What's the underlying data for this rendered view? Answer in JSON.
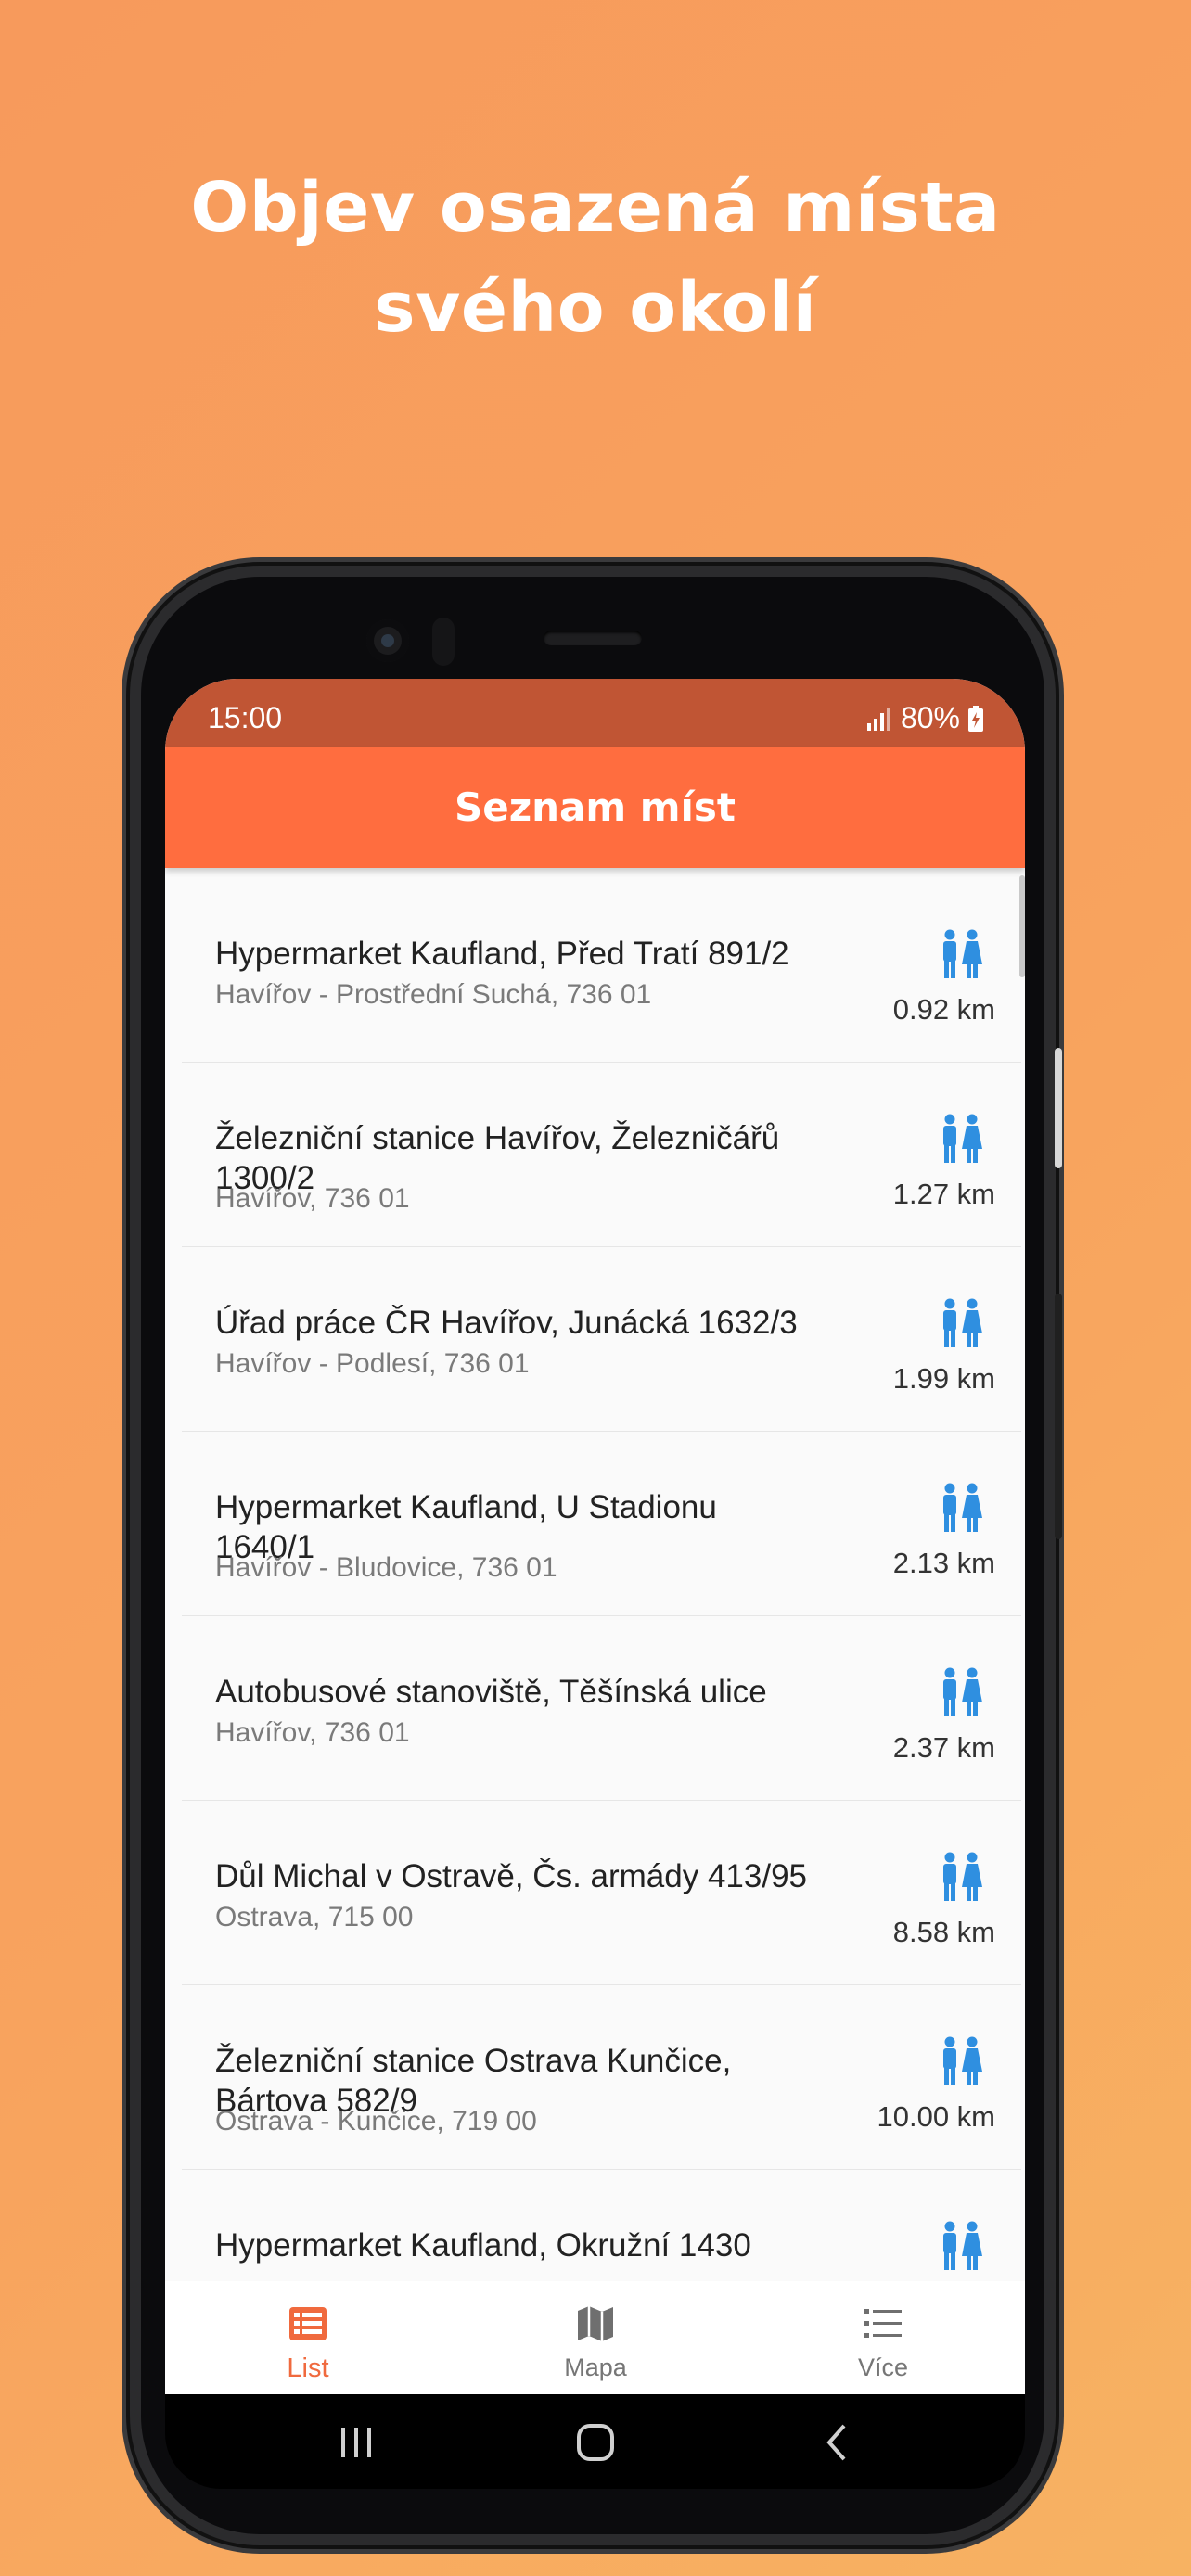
{
  "headline": {
    "line1": "Objev osazená místa",
    "line2": "svého okolí"
  },
  "status": {
    "time": "15:00",
    "battery": "80%"
  },
  "appbar": {
    "title": "Seznam míst"
  },
  "places": [
    {
      "title": "Hypermarket Kaufland, Před Tratí 891/2",
      "subtitle": "Havířov - Prostřední Suchá, 736 01",
      "distance": "0.92 km"
    },
    {
      "title": "Železniční stanice Havířov, Železničářů 1300/2",
      "subtitle": "Havířov, 736 01",
      "distance": "1.27 km"
    },
    {
      "title": "Úřad práce ČR Havířov, Junácká 1632/3",
      "subtitle": "Havířov - Podlesí, 736 01",
      "distance": "1.99 km"
    },
    {
      "title": "Hypermarket Kaufland, U Stadionu 1640/1",
      "subtitle": "Havířov - Bludovice, 736 01",
      "distance": "2.13 km"
    },
    {
      "title": "Autobusové stanoviště, Těšínská ulice",
      "subtitle": "Havířov, 736 01",
      "distance": "2.37 km"
    },
    {
      "title": "Důl Michal v Ostravě, Čs. armády 413/95",
      "subtitle": "Ostrava, 715 00",
      "distance": "8.58 km"
    },
    {
      "title": "Železniční stanice Ostrava Kunčice, Bártova 582/9",
      "subtitle": "Ostrava - Kunčice, 719 00",
      "distance": "10.00 km"
    },
    {
      "title": "Hypermarket Kaufland, Okružní 1430",
      "subtitle": "",
      "distance": ""
    }
  ],
  "place_icon": "restroom-icon",
  "nav": {
    "list_label": "List",
    "map_label": "Mapa",
    "more_label": "Více",
    "active": "list"
  },
  "colors": {
    "accent": "#ff6d3f",
    "status_bar": "#c05534",
    "icon_blue": "#2f8fe0"
  }
}
